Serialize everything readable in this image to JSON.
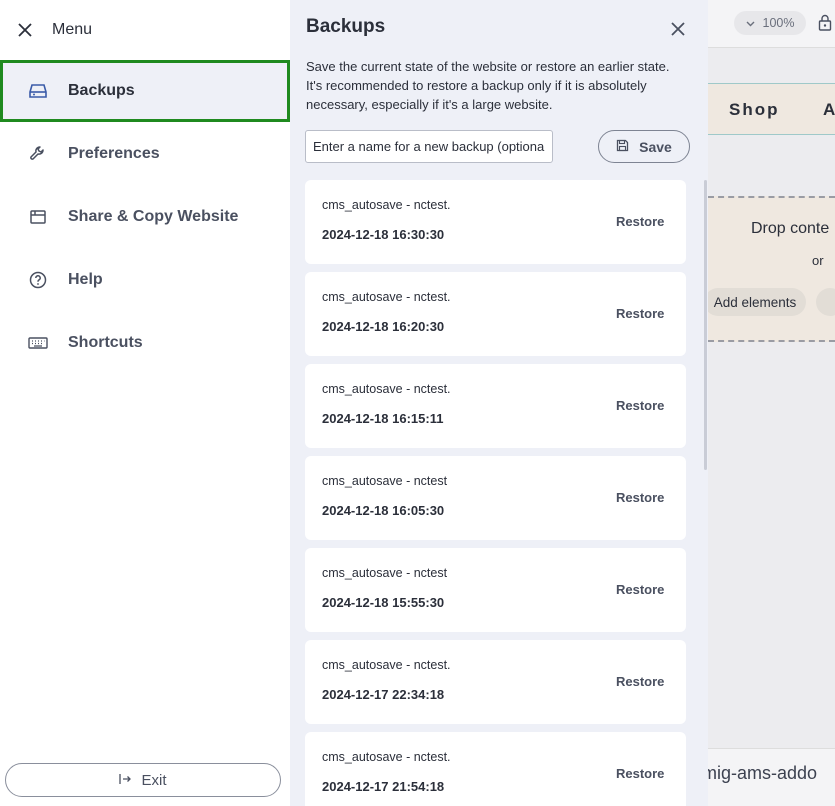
{
  "menu": {
    "title": "Menu",
    "items": [
      {
        "label": "Backups"
      },
      {
        "label": "Preferences"
      },
      {
        "label": "Share & Copy Website"
      },
      {
        "label": "Help"
      },
      {
        "label": "Shortcuts"
      }
    ],
    "exit_label": "Exit"
  },
  "panel": {
    "title": "Backups",
    "description": "Save the current state of the website or restore an earlier state. It's recommended to restore a backup only if it is absolutely necessary, especially if it's a large website.",
    "input_placeholder": "Enter a name for a new backup (optional)",
    "save_label": "Save",
    "restore_label": "Restore",
    "backups": [
      {
        "name": "cms_autosave - nctest.",
        "date": "2024-12-18 16:30:30"
      },
      {
        "name": "cms_autosave - nctest.",
        "date": "2024-12-18 16:20:30"
      },
      {
        "name": "cms_autosave - nctest.",
        "date": "2024-12-18 16:15:11"
      },
      {
        "name": "cms_autosave - nctest",
        "date": "2024-12-18 16:05:30"
      },
      {
        "name": "cms_autosave - nctest",
        "date": "2024-12-18 15:55:30"
      },
      {
        "name": "cms_autosave - nctest.",
        "date": "2024-12-17 22:34:18"
      },
      {
        "name": "cms_autosave - nctest.",
        "date": "2024-12-17 21:54:18"
      }
    ]
  },
  "site": {
    "zoom": "100%",
    "nav_shop": "Shop",
    "nav_a": "A",
    "drop_text": "Drop conte",
    "or_text": "or",
    "add_elements": "Add elements",
    "footer_text": "mig-ams-addo"
  },
  "colors": {
    "active_border": "#1f8a1f",
    "panel_bg": "#eef0f7",
    "card_bg": "#ffffff"
  }
}
